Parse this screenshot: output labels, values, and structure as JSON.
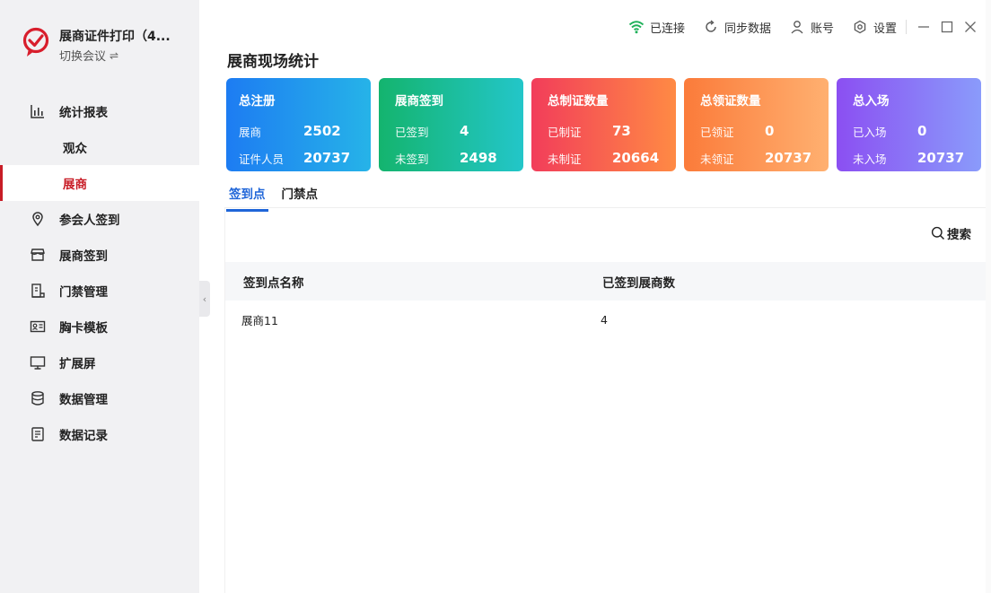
{
  "app": {
    "title": "展商证件打印（4...",
    "switch_label": "切换会议",
    "switch_icon": "⇌",
    "brand_color": "#d81e2c"
  },
  "sidebar": {
    "items": [
      {
        "label": "统计报表",
        "icon": "bar-chart-icon"
      },
      {
        "label": "观众",
        "sub": true
      },
      {
        "label": "展商",
        "sub": true,
        "active": true
      },
      {
        "label": "参会人签到",
        "icon": "location-pin-icon"
      },
      {
        "label": "展商签到",
        "icon": "store-icon"
      },
      {
        "label": "门禁管理",
        "icon": "gate-icon"
      },
      {
        "label": "胸卡模板",
        "icon": "id-card-icon"
      },
      {
        "label": "扩展屏",
        "icon": "monitor-icon"
      },
      {
        "label": "数据管理",
        "icon": "database-icon"
      },
      {
        "label": "数据记录",
        "icon": "document-icon"
      }
    ],
    "collapse_glyph": "‹"
  },
  "topbar": {
    "connection": "已连接",
    "connection_color": "#1fb15a",
    "sync": "同步数据",
    "account": "账号",
    "settings": "设置"
  },
  "page": {
    "title": "展商现场统计"
  },
  "cards": [
    {
      "title": "总注册",
      "rows": [
        {
          "label": "展商",
          "value": "2502"
        },
        {
          "label": "证件人员",
          "value": "20737"
        }
      ]
    },
    {
      "title": "展商签到",
      "rows": [
        {
          "label": "已签到",
          "value": "4"
        },
        {
          "label": "未签到",
          "value": "2498"
        }
      ]
    },
    {
      "title": "总制证数量",
      "rows": [
        {
          "label": "已制证",
          "value": "73"
        },
        {
          "label": "未制证",
          "value": "20664"
        }
      ]
    },
    {
      "title": "总领证数量",
      "rows": [
        {
          "label": "已领证",
          "value": "0"
        },
        {
          "label": "未领证",
          "value": "20737"
        }
      ]
    },
    {
      "title": "总入场",
      "rows": [
        {
          "label": "已入场",
          "value": "0"
        },
        {
          "label": "未入场",
          "value": "20737"
        }
      ]
    }
  ],
  "tabs": [
    {
      "label": "签到点",
      "active": true
    },
    {
      "label": "门禁点",
      "active": false
    }
  ],
  "search": {
    "label": "搜索"
  },
  "table": {
    "headers": [
      "签到点名称",
      "已签到展商数"
    ],
    "rows": [
      [
        "展商11",
        "4"
      ]
    ]
  }
}
